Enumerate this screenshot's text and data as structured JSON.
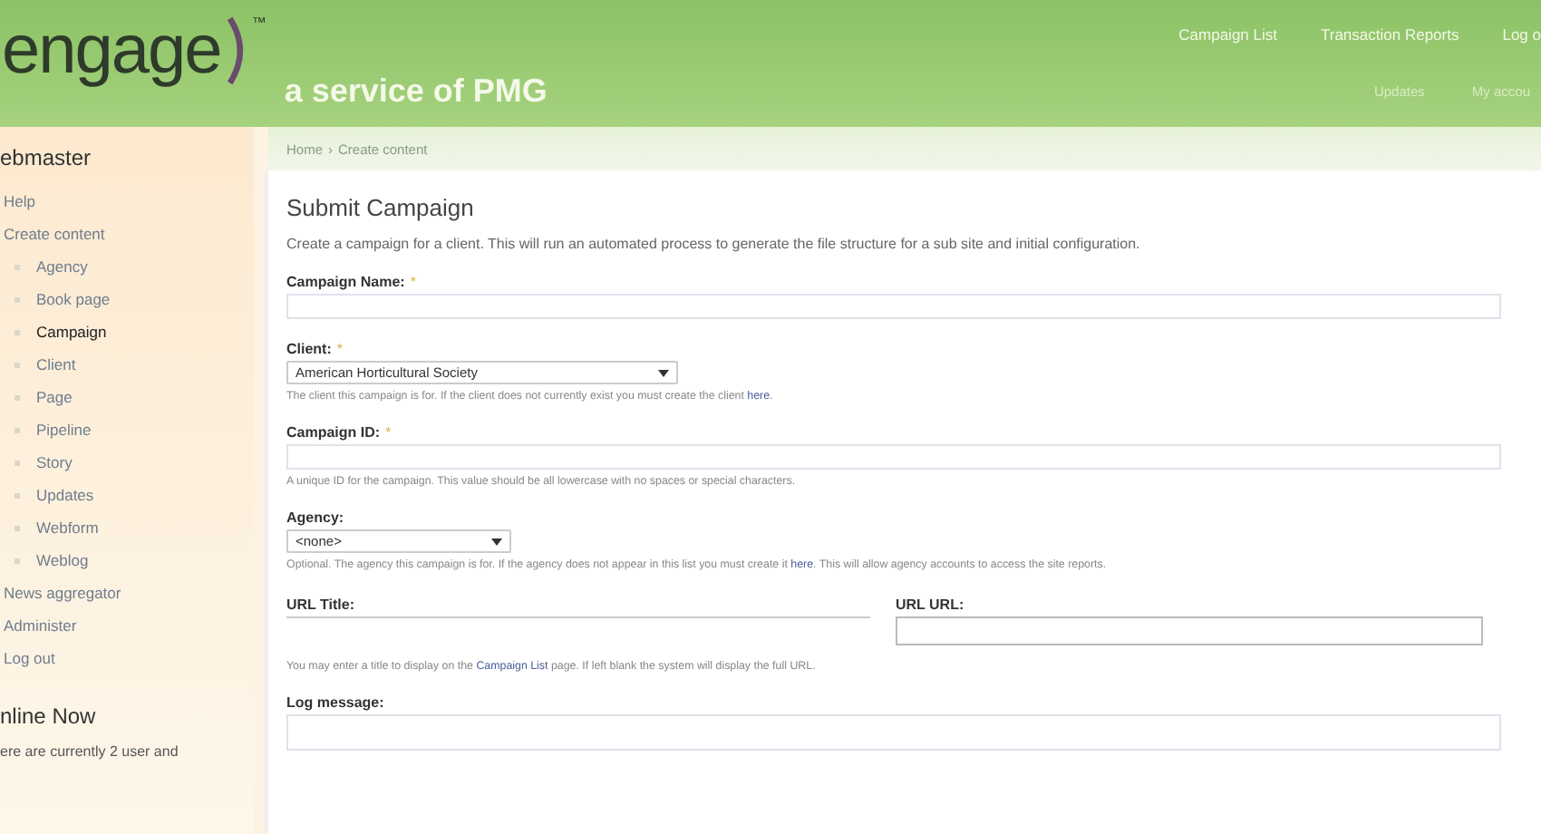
{
  "header": {
    "logo": "engage",
    "trademark": "™",
    "tagline": "a service of PMG",
    "primary_links": [
      {
        "label": "Campaign List"
      },
      {
        "label": "Transaction Reports"
      },
      {
        "label": "Log o"
      }
    ],
    "secondary_links": [
      {
        "label": "Updates"
      },
      {
        "label": "My accou"
      }
    ]
  },
  "breadcrumb": [
    {
      "label": "Home"
    },
    {
      "separator": "›",
      "label": "Create content"
    }
  ],
  "sidebar": {
    "title": "ebmaster",
    "items": [
      {
        "label": "Help",
        "selected": false
      },
      {
        "label": "Create content",
        "selected": false,
        "children": [
          {
            "label": "Agency",
            "selected": false
          },
          {
            "label": "Book page",
            "selected": false
          },
          {
            "label": "Campaign",
            "selected": true
          },
          {
            "label": "Client",
            "selected": false
          },
          {
            "label": "Page",
            "selected": false
          },
          {
            "label": "Pipeline",
            "selected": false
          },
          {
            "label": "Story",
            "selected": false
          },
          {
            "label": "Updates",
            "selected": false
          },
          {
            "label": "Webform",
            "selected": false
          },
          {
            "label": "Weblog",
            "selected": false
          }
        ]
      },
      {
        "label": "News aggregator",
        "selected": false
      },
      {
        "label": "Administer",
        "selected": false
      },
      {
        "label": "Log out",
        "selected": false
      }
    ],
    "block_title": "nline Now",
    "block_text": "ere are currently 2 user and"
  },
  "page": {
    "title": "Submit Campaign",
    "description": "Create a campaign for a client. This will run an automated process to generate the file structure for a sub site and initial configuration.",
    "fields": [
      {
        "kind": "text",
        "label": "Campaign Name:",
        "required_mark": "*"
      },
      {
        "kind": "select",
        "label": "Client:",
        "required_mark": "*",
        "value": "American Horticultural Society",
        "help": [
          {
            "text": "The client this campaign is for. If the client does not currently exist you must create the client "
          },
          {
            "link": "here"
          },
          {
            "text": "."
          }
        ]
      },
      {
        "kind": "text",
        "label": "Campaign ID:",
        "required_mark": "*",
        "help": [
          {
            "text": "A unique ID for the campaign. This value should be all lowercase with no spaces or special characters."
          }
        ]
      },
      {
        "kind": "select",
        "label": "Agency:",
        "value": "<none>",
        "help": [
          {
            "text": "Optional. The agency this campaign is for. If the agency does not appear in this list you must create it "
          },
          {
            "link": "here"
          },
          {
            "text": ". This will allow agency accounts to access the site reports."
          }
        ]
      },
      {
        "kind": "pair",
        "fields": [
          {
            "kind": "line",
            "label": "URL Title:",
            "help": [
              {
                "text": "You may enter a title to display on the "
              },
              {
                "link": "Campaign List"
              },
              {
                "text": " page. If left blank the system will display the full URL."
              }
            ]
          },
          {
            "kind": "text",
            "label": "URL URL:"
          }
        ]
      },
      {
        "kind": "textarea",
        "label": "Log message:"
      }
    ]
  }
}
